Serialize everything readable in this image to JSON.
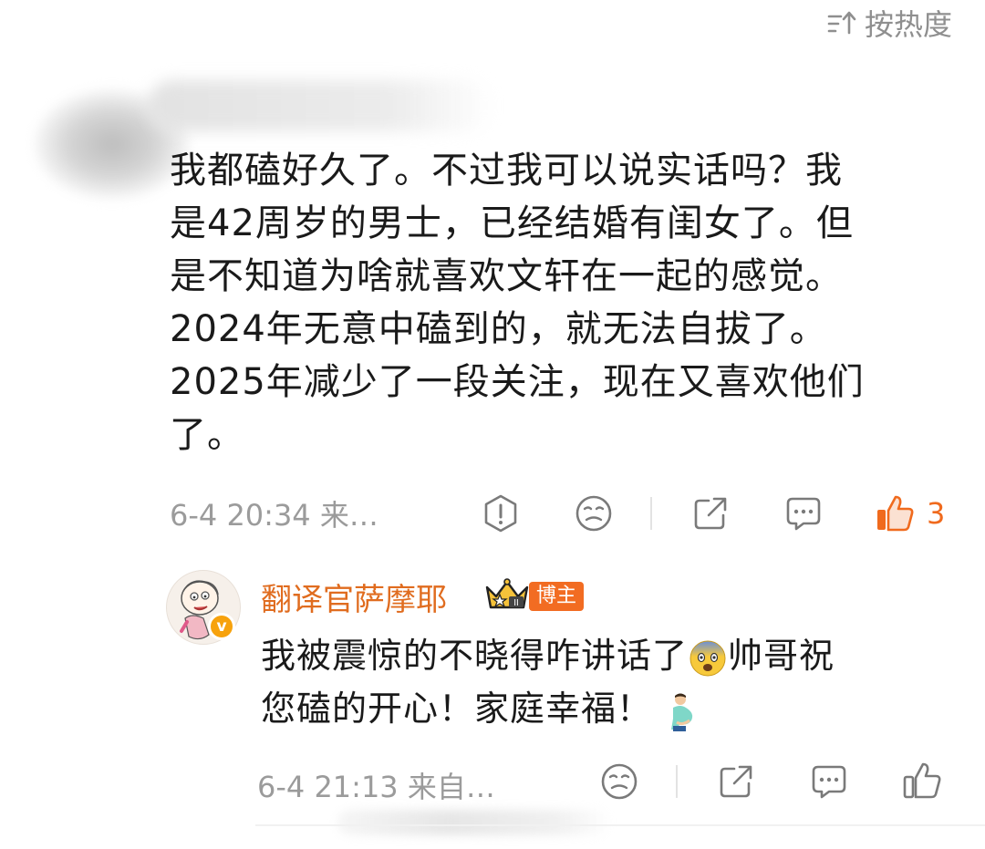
{
  "sort_bar": {
    "label": "按热度",
    "icon": "sort-icon"
  },
  "comment": {
    "lines": [
      "我都磕好久了。不过我可以说实话吗？我",
      "是42周岁的男士，已经结婚有闺女了。但",
      "是不知道为啥就喜欢文轩在一起的感觉。",
      "2024年无意中磕到的，就无法自拔了。",
      "2025年减少了一段关注，现在又喜欢他们",
      "了。"
    ],
    "time": "6-4 20:34  来…",
    "like_count": "3",
    "icons": [
      "report-icon",
      "dislike-icon",
      "share-icon",
      "comment-icon",
      "like-icon"
    ],
    "like_color": "#f06a1d"
  },
  "reply": {
    "author": "翻译官萨摩耶",
    "owner_badge": "博主",
    "verified_mark": "v",
    "lines": [
      "我被震惊的不晓得咋讲话了",
      "帅哥祝",
      "您磕的开心！家庭幸福！"
    ],
    "time": "6-4 21:13  来自…",
    "icons": [
      "dislike-icon",
      "share-icon",
      "comment-icon",
      "like-icon"
    ],
    "name_color": "#e06c1f",
    "badge_color": "#f26c22"
  }
}
